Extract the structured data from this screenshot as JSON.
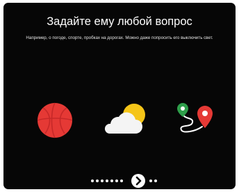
{
  "screen": {
    "title": "Задайте ему любой вопрос",
    "subtitle": "Например, о погоде, спорте, пробках на дорогах. Можно даже попросить его выключить свет."
  },
  "icons": [
    "sports-ball-icon",
    "weather-icon",
    "route-map-icon"
  ],
  "pager": {
    "dots_before": 7,
    "dots_after": 2,
    "next_icon": "chevron-right-icon"
  },
  "colors": {
    "background": "#060606",
    "text": "#ffffff",
    "ball_red": "#e53935",
    "sun_yellow": "#f5c518",
    "pin_red": "#e53935",
    "pin_green": "#2e9e4a"
  }
}
